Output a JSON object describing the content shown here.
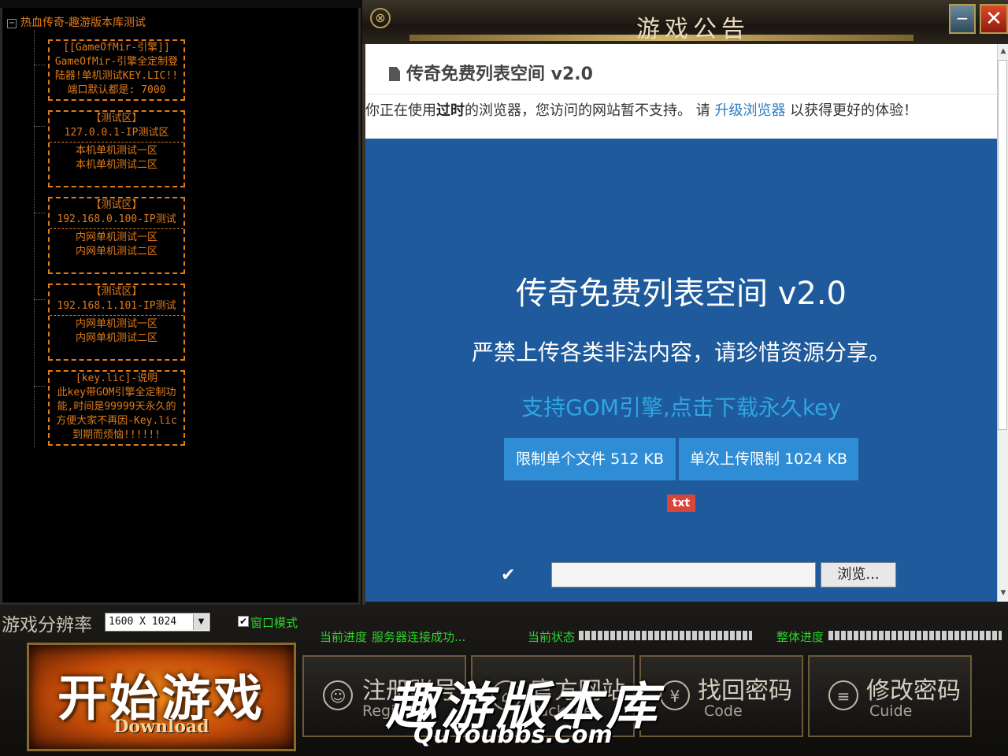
{
  "tree": {
    "root": "热血传奇-趣游版本库测试",
    "groups": [
      {
        "title": "[[GameOfMir-引擎]]",
        "lines": [
          "GameOfMir-引擎全定制登",
          "陆器!单机测试KEY.LIC!!",
          "端口默认都是: 7000"
        ]
      },
      {
        "title": "【测试区】",
        "lines": [
          "127.0.0.1-IP测试区"
        ],
        "sub": [
          "本机单机测试一区",
          "本机单机测试二区"
        ]
      },
      {
        "title": "【测试区】",
        "lines": [
          "192.168.0.100-IP测试"
        ],
        "sub": [
          "内网单机测试一区",
          "内网单机测试二区"
        ]
      },
      {
        "title": "【测试区】",
        "lines": [
          "192.168.1.101-IP测试"
        ],
        "sub": [
          "内网单机测试一区",
          "内网单机测试二区"
        ]
      },
      {
        "title": "[key.lic]-说明",
        "lines": [
          "此key带GOM引擎全定制功",
          "能,时间是99999天永久的",
          "方便大家不再因-Key.lic",
          "到期而烦恼!!!!!!"
        ]
      }
    ]
  },
  "notice": {
    "title": "游戏公告",
    "min_glyph": "−",
    "close_glyph": "✕",
    "left_glyph": "⊗"
  },
  "browser": {
    "page_header": "传奇免费列表空间 v2.0",
    "warn_pre": "你正在使用",
    "warn_bold": "过时",
    "warn_mid": "的浏览器，您访问的网站暂不支持。 请 ",
    "warn_link": "升级浏览器",
    "warn_post": " 以获得更好的体验！",
    "hero_title": "传奇免费列表空间 v2.0",
    "hero_sub": "严禁上传各类非法内容，请珍惜资源分享。",
    "hero_link": "支持GOM引擎,点击下载永久key",
    "btn_file": "限制单个文件 512 KB",
    "btn_upload": "单次上传限制 1024 KB",
    "tag": "txt",
    "check": "✔",
    "browse": "浏览...",
    "scroll_up": "▲",
    "scroll_down": "▼"
  },
  "bottom": {
    "res_label": "游戏分辨率",
    "res_value": "1600 X 1024",
    "res_arrow": "▼",
    "window_mode_check": "✔",
    "window_mode": "窗口模式",
    "progress_cur_label": "当前进度",
    "progress_cur_text": "服务器连接成功...",
    "status_label": "当前状态",
    "overall_label": "整体进度",
    "start_title": "开始游戏",
    "start_sub": "Download",
    "menu": [
      {
        "cn": "注册账号",
        "en": "Register",
        "icon": "☺"
      },
      {
        "cn": "官方网站",
        "en": "Package",
        "icon": "⌂"
      },
      {
        "cn": "找回密码",
        "en": "Code",
        "icon": "¥"
      },
      {
        "cn": "修改密码",
        "en": "Cuide",
        "icon": "≡"
      }
    ],
    "watermark_cn": "趣游版本库",
    "watermark_en": "QuYoubbs.Com"
  }
}
